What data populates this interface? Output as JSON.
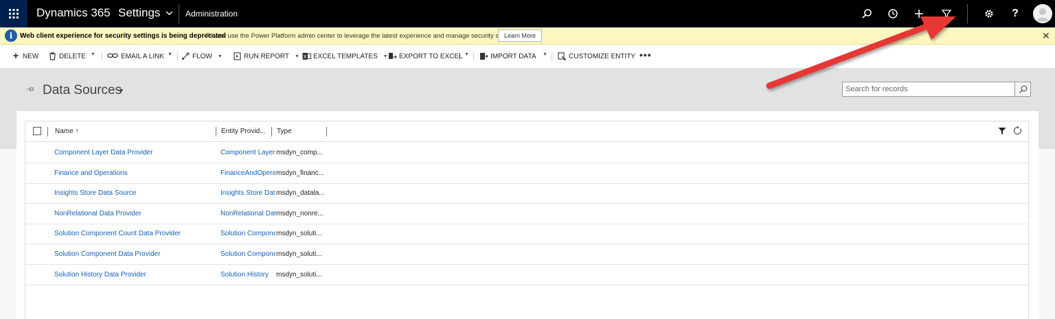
{
  "topnav": {
    "app_title": "Dynamics 365",
    "area": "Settings",
    "crumb": "Administration",
    "icons": [
      "waffle-icon",
      "search-icon",
      "history-icon",
      "plus-icon",
      "filter-icon",
      "gear-icon",
      "help-icon",
      "avatar"
    ],
    "bg_color": "#000000",
    "waffle_color": "#002050"
  },
  "banner": {
    "title": "Web client experience for security settings is being deprecated",
    "message": "Please use the Power Platform admin center to leverage the latest experience and manage security settings",
    "button": "Learn More",
    "close": "✕",
    "bg_color": "#fdf6c0"
  },
  "commandbar": {
    "new": "NEW",
    "delete": "DELETE",
    "email_link": "EMAIL A LINK",
    "flow": "FLOW",
    "run_report": "RUN REPORT",
    "excel_templates": "EXCEL TEMPLATES",
    "export_excel": "EXPORT TO EXCEL",
    "import_data": "IMPORT DATA",
    "customize_entity": "CUSTOMIZE ENTITY",
    "more": "•••"
  },
  "view": {
    "title": "Data Sources",
    "search_placeholder": "Search for records"
  },
  "grid": {
    "columns": [
      "Name ↑",
      "Entity Provid...",
      "Type"
    ],
    "rows": [
      {
        "name": "Component Layer Data Provider",
        "entity": "Component Layer",
        "type": "msdyn_comp..."
      },
      {
        "name": "Finance and Operations",
        "entity": "FinanceAndOperations",
        "type": "msdyn_financ..."
      },
      {
        "name": "Insights Store Data Source",
        "entity": "Insights Store Data",
        "type": "msdyn_datala..."
      },
      {
        "name": "NonRelational Data Provider",
        "entity": "NonRelational Data",
        "type": "msdyn_nonre..."
      },
      {
        "name": "Solution Component Count Data Provider",
        "entity": "Solution Component",
        "type": "msdyn_soluti..."
      },
      {
        "name": "Solution Component Data Provider",
        "entity": "Solution Component",
        "type": "msdyn_soluti..."
      },
      {
        "name": "Solution History Data Provider",
        "entity": "Solution History",
        "type": "msdyn_soluti..."
      }
    ],
    "link_color": "#1160b7"
  },
  "annotation": {
    "arrow_color": "#e53935"
  }
}
